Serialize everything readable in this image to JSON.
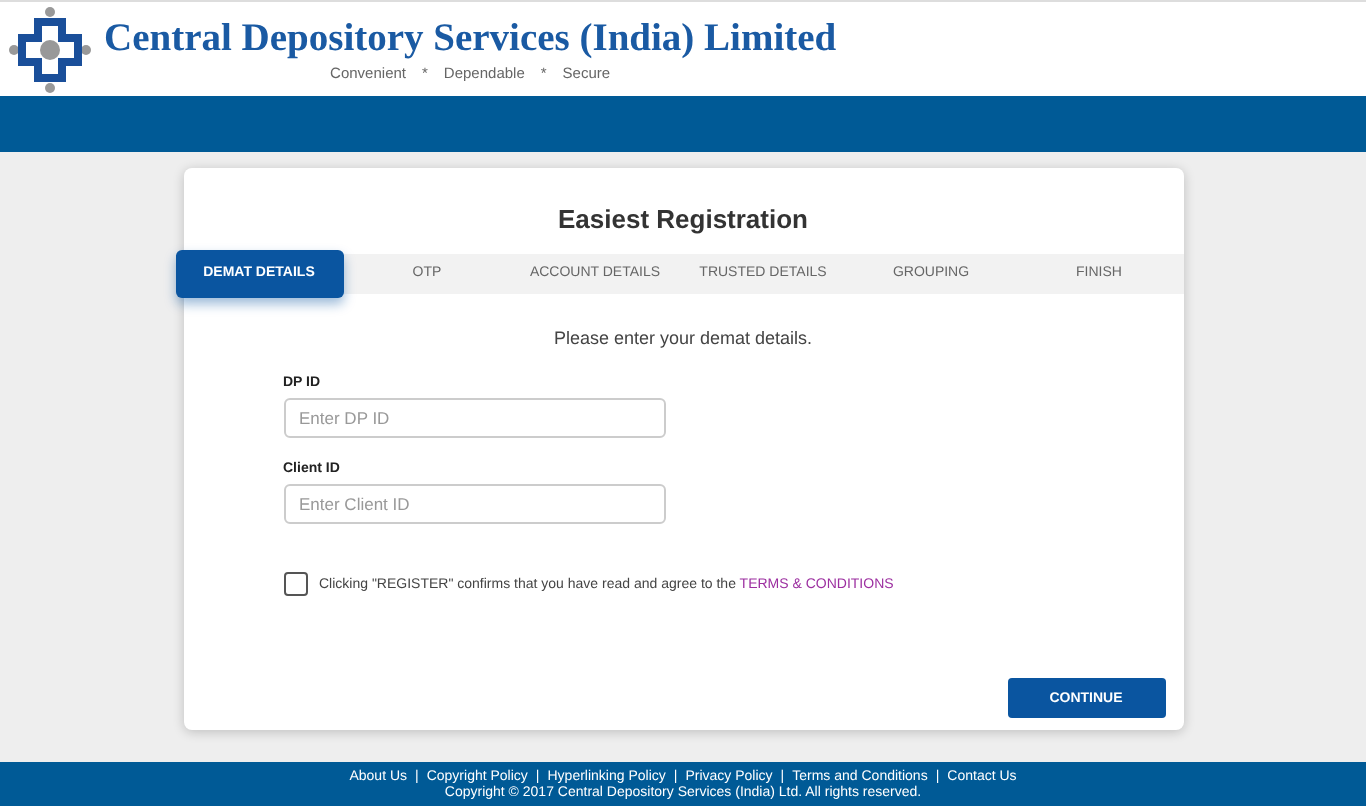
{
  "header": {
    "title": "Central Depository Services (India) Limited",
    "tagline": [
      "Convenient",
      "Dependable",
      "Secure"
    ],
    "tagline_separator": "*"
  },
  "card": {
    "title": "Easiest Registration",
    "steps": [
      {
        "label": "DEMAT DETAILS",
        "selected": true
      },
      {
        "label": "OTP",
        "selected": false
      },
      {
        "label": "ACCOUNT DETAILS",
        "selected": false
      },
      {
        "label": "TRUSTED DETAILS",
        "selected": false
      },
      {
        "label": "GROUPING",
        "selected": false
      },
      {
        "label": "FINISH",
        "selected": false
      }
    ],
    "prompt": "Please enter your demat details.",
    "fields": [
      {
        "label": "DP ID",
        "placeholder": "Enter DP ID"
      },
      {
        "label": "Client ID",
        "placeholder": "Enter Client ID"
      }
    ],
    "consent": {
      "checked": false,
      "text": "Clicking \"REGISTER\" confirms that you have read and agree to the",
      "link": "TERMS & CONDITIONS"
    },
    "button": "CONTINUE"
  },
  "footer": {
    "separator": "|",
    "links": [
      "About Us",
      "Copyright Policy",
      "Hyperlinking Policy",
      "Privacy Policy",
      "Terms and Conditions",
      "Contact Us"
    ],
    "copyright": "Copyright © 2017 Central Depository Services (India) Ltd. All rights reserved."
  }
}
